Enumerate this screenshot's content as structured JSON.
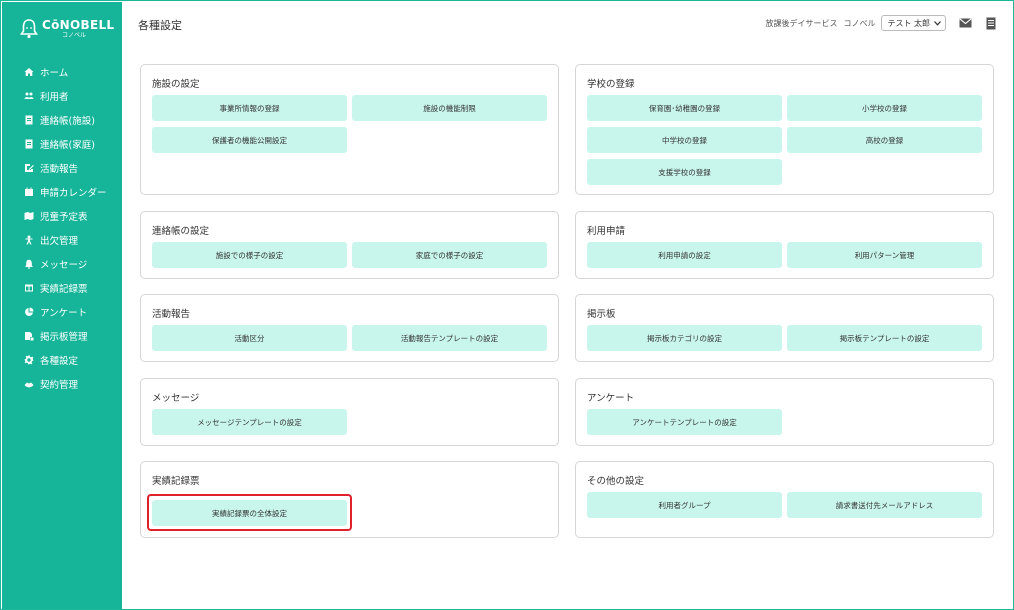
{
  "app": {
    "logo_title": "CōNOBELL",
    "logo_sub": "コノベル"
  },
  "sidebar": {
    "items": [
      {
        "label": "ホーム",
        "icon": "home-icon"
      },
      {
        "label": "利用者",
        "icon": "users-icon"
      },
      {
        "label": "連絡帳(施設)",
        "icon": "contact-book-icon"
      },
      {
        "label": "連絡帳(家庭)",
        "icon": "contact-book-icon"
      },
      {
        "label": "活動報告",
        "icon": "edit-icon"
      },
      {
        "label": "申請カレンダー",
        "icon": "calendar-icon"
      },
      {
        "label": "児童予定表",
        "icon": "map-icon"
      },
      {
        "label": "出欠管理",
        "icon": "person-icon"
      },
      {
        "label": "メッセージ",
        "icon": "bell-icon"
      },
      {
        "label": "実績記録票",
        "icon": "table-icon"
      },
      {
        "label": "アンケート",
        "icon": "pie-icon"
      },
      {
        "label": "掲示板管理",
        "icon": "board-icon"
      },
      {
        "label": "各種設定",
        "icon": "gear-icon"
      },
      {
        "label": "契約管理",
        "icon": "handshake-icon"
      }
    ]
  },
  "header": {
    "title": "各種設定",
    "service_name": "放課後デイサービス",
    "facility_name": "コノベル",
    "user_name": "テスト 太郎"
  },
  "cards": {
    "facility": {
      "title": "施設の設定",
      "buttons": [
        "事業所情報の登録",
        "施設の機能制限",
        "保護者の機能公開設定"
      ]
    },
    "school": {
      "title": "学校の登録",
      "buttons": [
        "保育園･幼稚園の登録",
        "小学校の登録",
        "中学校の登録",
        "高校の登録",
        "支援学校の登録"
      ]
    },
    "contact": {
      "title": "連絡帳の設定",
      "buttons": [
        "施設での様子の設定",
        "家庭での様子の設定"
      ]
    },
    "usage": {
      "title": "利用申請",
      "buttons": [
        "利用申請の設定",
        "利用パターン管理"
      ]
    },
    "activity": {
      "title": "活動報告",
      "buttons": [
        "活動区分",
        "活動報告テンプレートの設定"
      ]
    },
    "board": {
      "title": "掲示板",
      "buttons": [
        "掲示板カテゴリの設定",
        "掲示板テンプレートの設定"
      ]
    },
    "message": {
      "title": "メッセージ",
      "buttons": [
        "メッセージテンプレートの設定"
      ]
    },
    "survey": {
      "title": "アンケート",
      "buttons": [
        "アンケートテンプレートの設定"
      ]
    },
    "record": {
      "title": "実績記録票",
      "buttons": [
        "実績記録票の全体設定"
      ]
    },
    "other": {
      "title": "その他の設定",
      "buttons": [
        "利用者グループ",
        "請求書送付先メールアドレス"
      ]
    }
  },
  "colors": {
    "sidebar": "#16b59a",
    "button": "#c9f6ec",
    "highlight": "#e0202a"
  }
}
